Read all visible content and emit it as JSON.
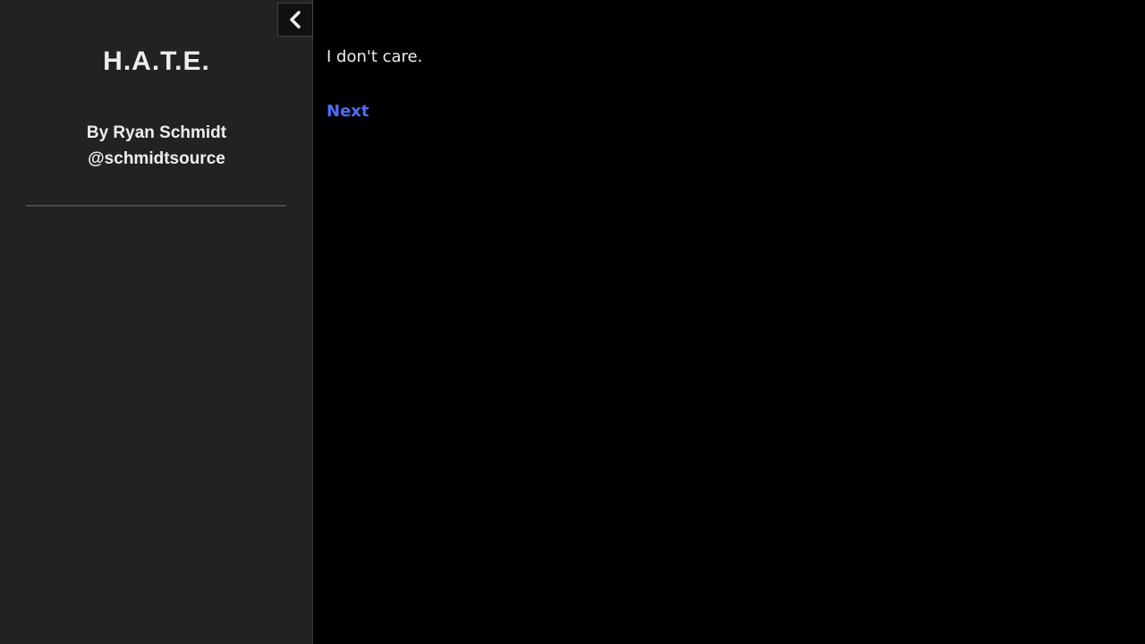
{
  "sidebar": {
    "title": "H.A.T.E.",
    "author_line": "By Ryan Schmidt",
    "author_handle": "@schmidtsource",
    "toggle_icon": "chevron-left-icon"
  },
  "passage": {
    "text": "I don't care.",
    "link_label": "Next"
  },
  "colors": {
    "sidebar_bg": "#222222",
    "main_bg": "#000000",
    "text": "#eeeeee",
    "link": "#4f6ef7"
  }
}
